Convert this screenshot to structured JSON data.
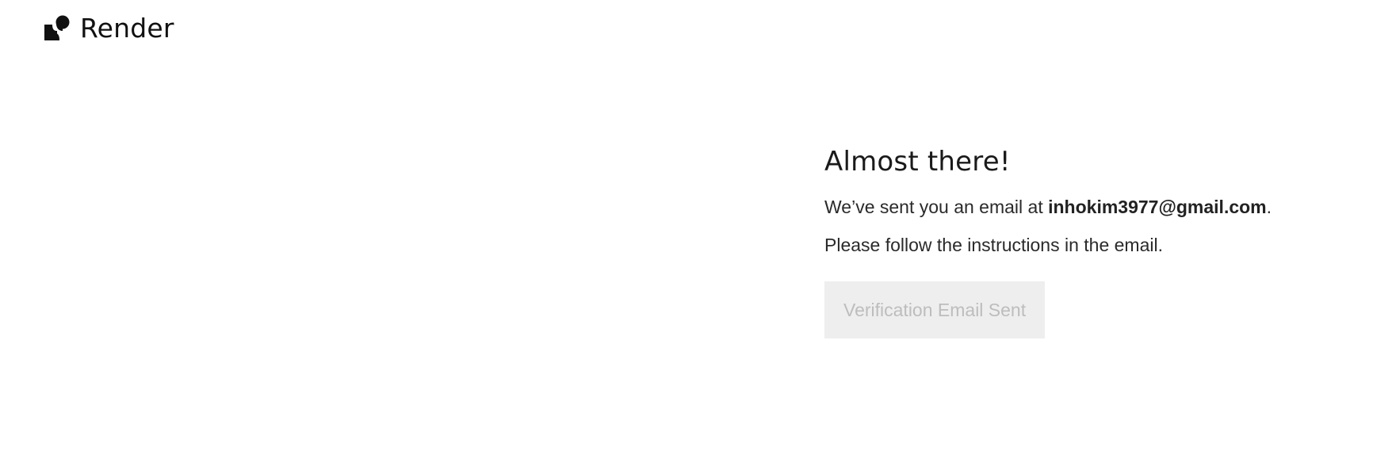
{
  "brand": {
    "name": "Render",
    "logo_icon": "render-logo-icon"
  },
  "main": {
    "heading": "Almost there!",
    "sent_prefix": "We’ve sent you an email at ",
    "email": "inhokim3977@gmail.com",
    "sent_suffix": ".",
    "instructions": "Please follow the instructions in the email.",
    "button_label": "Verification Email Sent",
    "button_state": "disabled"
  },
  "colors": {
    "background": "#ffffff",
    "text": "#1f1f1f",
    "button_bg": "#eeeeee",
    "button_text": "#bdbdbd"
  }
}
